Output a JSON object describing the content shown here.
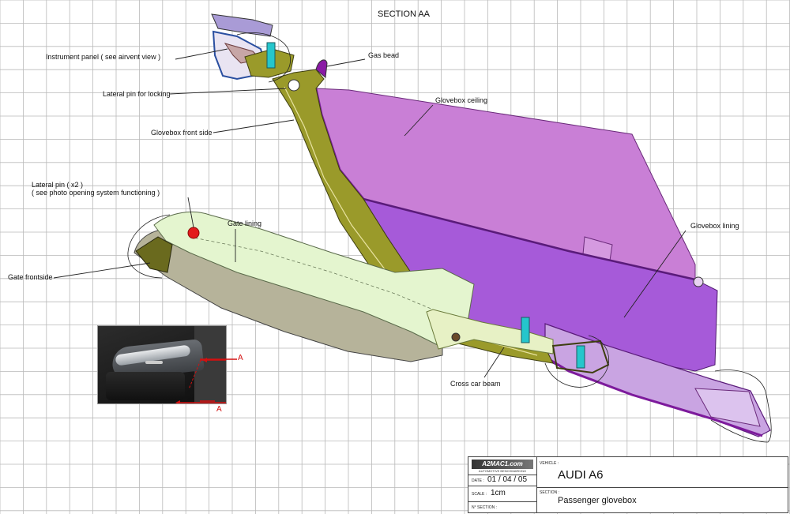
{
  "header": {
    "title": "SECTION AA"
  },
  "labels": {
    "instrument_panel": "Instrument panel ( see airvent view )",
    "gas_bead": "Gas bead",
    "lateral_pin_locking": "Lateral pin for locking",
    "glovebox_ceiling": "Glovebox ceiling",
    "glovebox_front_side": "Glovebox front side",
    "lateral_pin_x2": "Lateral pin ( x2 )",
    "lateral_pin_x2_note": "( see photo opening system functioning )",
    "gate_lining": "Gate lining",
    "gate_frontside": "Gate frontside",
    "glovebox_lining": "Glovebox lining",
    "cross_car_beam": "Cross car beam"
  },
  "photo": {
    "marker_1": "A",
    "marker_2": "A"
  },
  "title_block": {
    "logo": "A2MAC1.com",
    "logo_sub": "AUTOMOTIVE BENCHMARKING",
    "date_label": "DATE :",
    "date_value": "01 / 04 / 05",
    "scale_label": "SCALE :",
    "scale_value": "1cm",
    "section_no_label": "N° SECTION :",
    "vehicle_label": "VEHICLE :",
    "vehicle_value": "AUDI A6",
    "section_label": "SECTION :",
    "section_value": "Passenger glovebox"
  },
  "colors": {
    "grid": "#b9b9b9",
    "ceiling": "#c97fd6",
    "lining": "#a65ad9",
    "front_side": "#9a9a2a",
    "gate_lining": "#e4f5cf",
    "gate_body": "#b6b39a",
    "pin_red": "#e31b1b",
    "marker_red": "#d41010"
  }
}
